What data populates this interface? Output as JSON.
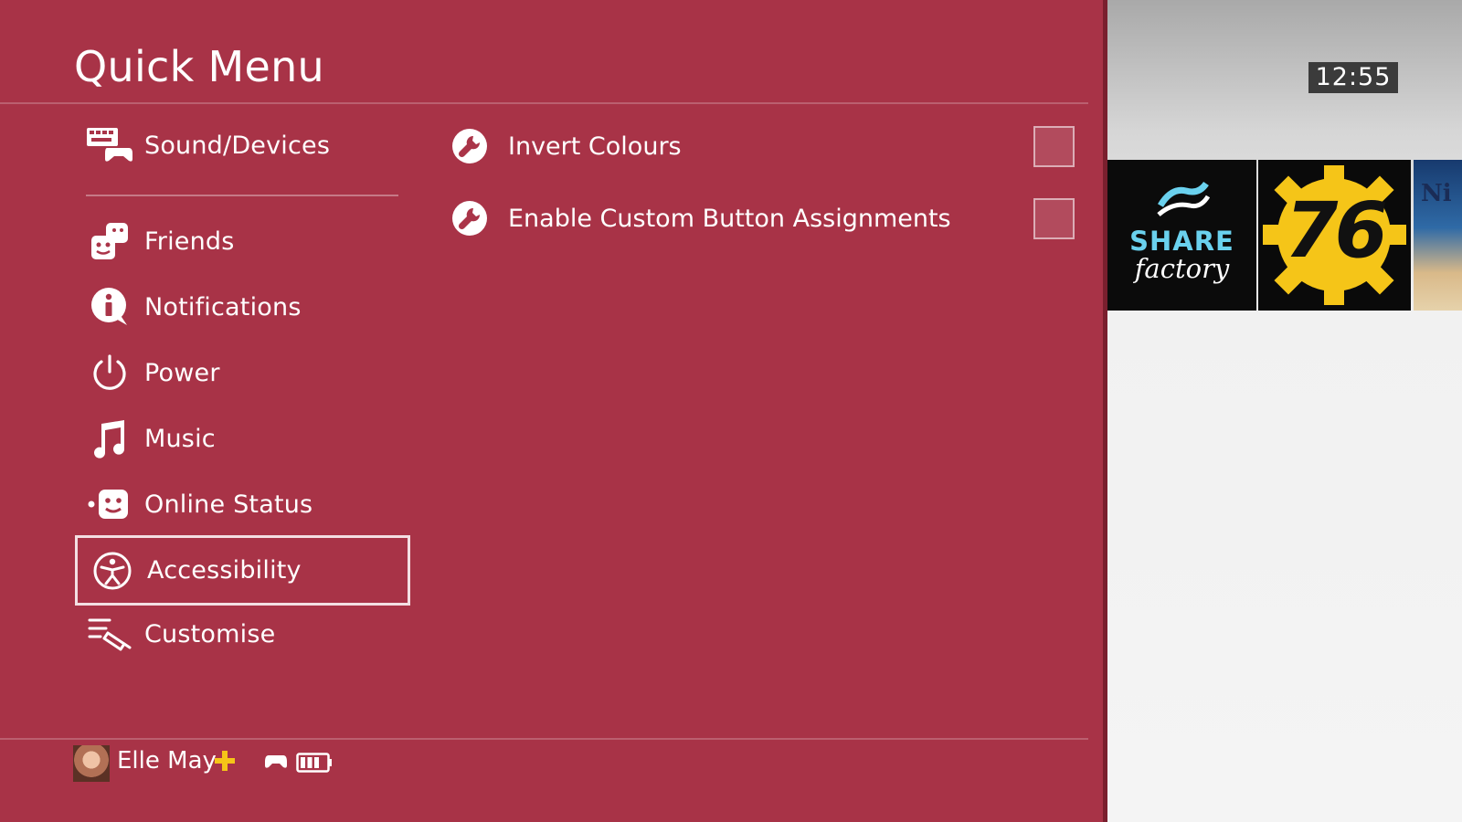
{
  "clock": "12:55",
  "quick_menu": {
    "title": "Quick Menu",
    "items": [
      {
        "label": "Sound/Devices",
        "icon": "keyboard-controller-icon"
      },
      {
        "label": "Friends",
        "icon": "friends-icon"
      },
      {
        "label": "Notifications",
        "icon": "notifications-icon"
      },
      {
        "label": "Power",
        "icon": "power-icon"
      },
      {
        "label": "Music",
        "icon": "music-note-icon"
      },
      {
        "label": "Online Status",
        "icon": "online-status-icon"
      },
      {
        "label": "Accessibility",
        "icon": "accessibility-icon",
        "selected": true
      },
      {
        "label": "Customise",
        "icon": "customise-icon"
      }
    ]
  },
  "options": [
    {
      "label": "Invert Colours",
      "icon": "wrench-icon",
      "checked": false
    },
    {
      "label": "Enable Custom Button Assignments",
      "icon": "wrench-icon",
      "checked": false
    }
  ],
  "footer": {
    "user_name": "Elle May",
    "plus_icon": "ps-plus-icon",
    "controller_icon": "controller-icon",
    "battery_icon": "battery-icon",
    "battery_level": 0.75
  },
  "tiles": {
    "share_factory": {
      "line1": "SHARE",
      "line2": "factory"
    },
    "fallout": {
      "text": "76"
    },
    "third": {
      "text": "Ni"
    }
  },
  "colors": {
    "panel": "#aa3448",
    "accent_plus": "#f5c518",
    "share_blue": "#6ad1ee",
    "fallout_yellow": "#f5c518"
  }
}
